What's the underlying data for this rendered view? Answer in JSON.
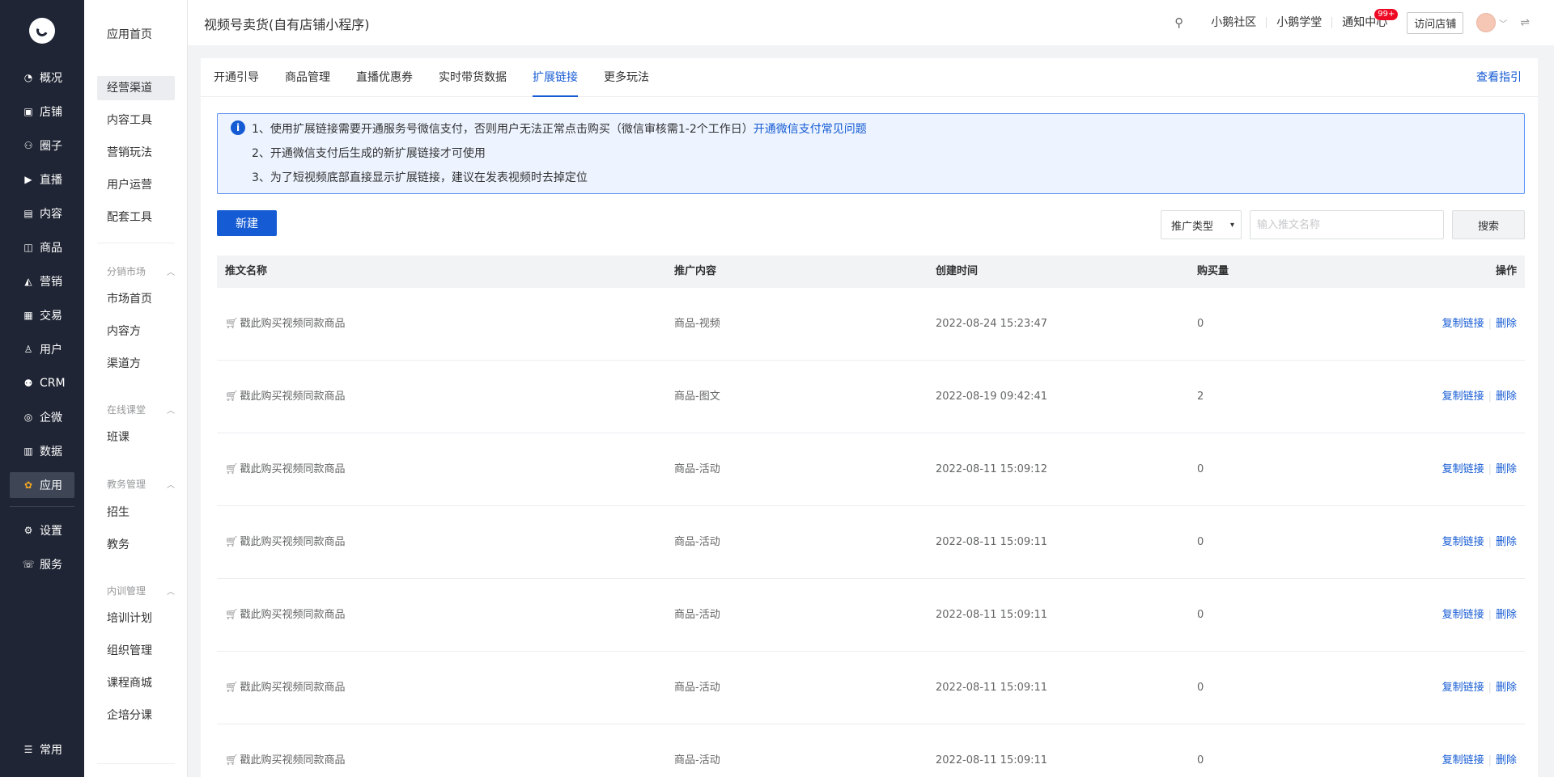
{
  "app": {
    "page_title": "视频号卖货(自有店铺小程序)"
  },
  "rail": {
    "items": [
      {
        "label": "概况",
        "icon": "dashboard-icon"
      },
      {
        "label": "店铺",
        "icon": "store-icon"
      },
      {
        "label": "圈子",
        "icon": "community-icon"
      },
      {
        "label": "直播",
        "icon": "live-icon"
      },
      {
        "label": "内容",
        "icon": "content-icon"
      },
      {
        "label": "商品",
        "icon": "goods-icon"
      },
      {
        "label": "营销",
        "icon": "marketing-icon"
      },
      {
        "label": "交易",
        "icon": "trade-icon"
      },
      {
        "label": "用户",
        "icon": "user-icon"
      },
      {
        "label": "CRM",
        "icon": "crm-icon"
      },
      {
        "label": "企微",
        "icon": "wecom-icon"
      },
      {
        "label": "数据",
        "icon": "data-icon"
      },
      {
        "label": "应用",
        "icon": "apps-icon"
      },
      {
        "label": "设置",
        "icon": "settings-icon"
      },
      {
        "label": "服务",
        "icon": "service-icon"
      }
    ],
    "bottom_label": "常用"
  },
  "side": {
    "home": "应用首页",
    "main_items": [
      "经营渠道",
      "内容工具",
      "营销玩法",
      "用户运营",
      "配套工具"
    ],
    "groups": [
      {
        "title": "分销市场",
        "items": [
          "市场首页",
          "内容方",
          "渠道方"
        ]
      },
      {
        "title": "在线课堂",
        "items": [
          "班课"
        ]
      },
      {
        "title": "教务管理",
        "items": [
          "招生",
          "教务"
        ]
      },
      {
        "title": "内训管理",
        "items": [
          "培训计划",
          "组织管理",
          "课程商城",
          "企培分课"
        ]
      }
    ]
  },
  "topbar": {
    "links": [
      "小鹅社区",
      "小鹅学堂",
      "通知中心"
    ],
    "badge": "99+",
    "visit_store": "访问店铺"
  },
  "tabs": [
    "开通引导",
    "商品管理",
    "直播优惠券",
    "实时带货数据",
    "扩展链接",
    "更多玩法"
  ],
  "active_tab": "扩展链接",
  "guide_link": "查看指引",
  "notice": {
    "line1": "1、使用扩展链接需要开通服务号微信支付，否则用户无法正常点击购买（微信审核需1-2个工作日）",
    "line1_link": "开通微信支付常见问题",
    "line2": "2、开通微信支付后生成的新扩展链接才可使用",
    "line3": "3、为了短视频底部直接显示扩展链接，建议在发表视频时去掉定位"
  },
  "toolbar": {
    "new_label": "新建",
    "type_select": "推广类型",
    "search_placeholder": "输入推文名称",
    "search_label": "搜索"
  },
  "table": {
    "headers": [
      "推文名称",
      "推广内容",
      "创建时间",
      "购买量",
      "操作"
    ],
    "rows": [
      {
        "name": "戳此购买视频同款商品",
        "content": "商品-视频",
        "time": "2022-08-24 15:23:47",
        "qty": "0"
      },
      {
        "name": "戳此购买视频同款商品",
        "content": "商品-图文",
        "time": "2022-08-19 09:42:41",
        "qty": "2"
      },
      {
        "name": "戳此购买视频同款商品",
        "content": "商品-活动",
        "time": "2022-08-11 15:09:12",
        "qty": "0"
      },
      {
        "name": "戳此购买视频同款商品",
        "content": "商品-活动",
        "time": "2022-08-11 15:09:11",
        "qty": "0"
      },
      {
        "name": "戳此购买视频同款商品",
        "content": "商品-活动",
        "time": "2022-08-11 15:09:11",
        "qty": "0"
      },
      {
        "name": "戳此购买视频同款商品",
        "content": "商品-活动",
        "time": "2022-08-11 15:09:11",
        "qty": "0"
      },
      {
        "name": "戳此购买视频同款商品",
        "content": "商品-活动",
        "time": "2022-08-11 15:09:11",
        "qty": "0"
      }
    ],
    "op_copy": "复制链接",
    "op_delete": "删除"
  },
  "colors": {
    "rail_bg": "#1f2534",
    "accent": "#155bd4",
    "badge": "#ee0a24"
  }
}
